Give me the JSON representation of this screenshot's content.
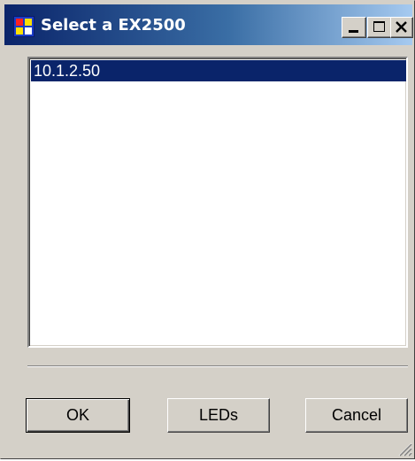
{
  "window": {
    "title": "Select a EX2500",
    "controls": {
      "minimize_icon": "minimize-icon",
      "maximize_icon": "maximize-icon",
      "close_icon": "close-icon"
    }
  },
  "list": {
    "items": [
      {
        "label": "10.1.2.50",
        "selected": true
      }
    ]
  },
  "buttons": {
    "ok_label": "OK",
    "leds_label": "LEDs",
    "cancel_label": "Cancel"
  },
  "colors": {
    "titlebar_start": "#0a246a",
    "titlebar_end": "#a6caf0",
    "selection": "#0a246a",
    "face": "#d4d0c8"
  }
}
